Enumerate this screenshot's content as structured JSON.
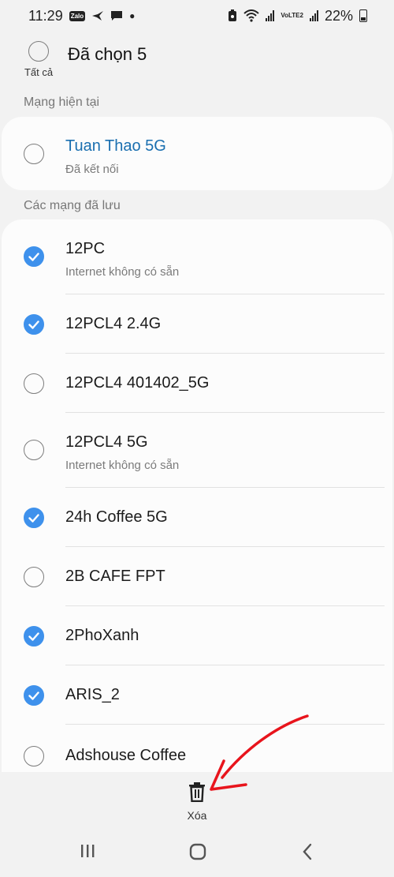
{
  "status_bar": {
    "time": "11:29",
    "zalo": "Zalo",
    "network": "VoLTE2",
    "battery": "22%"
  },
  "header": {
    "select_all_label": "Tất cả",
    "title": "Đã chọn 5"
  },
  "current_section": {
    "label": "Mạng hiện tại",
    "network": {
      "name": "Tuan Thao 5G",
      "status": "Đã kết nối",
      "checked": false
    }
  },
  "saved_section": {
    "label": "Các mạng đã lưu",
    "networks": [
      {
        "name": "12PC",
        "status": "Internet không có sẵn",
        "checked": true
      },
      {
        "name": "12PCL4 2.4G",
        "status": "",
        "checked": true
      },
      {
        "name": "12PCL4 401402_5G",
        "status": "",
        "checked": false
      },
      {
        "name": "12PCL4 5G",
        "status": "Internet không có sẵn",
        "checked": false
      },
      {
        "name": "24h Coffee 5G",
        "status": "",
        "checked": true
      },
      {
        "name": "2B CAFE FPT",
        "status": "",
        "checked": false
      },
      {
        "name": "2PhoXanh",
        "status": "",
        "checked": true
      },
      {
        "name": "ARIS_2",
        "status": "",
        "checked": true
      },
      {
        "name": "Adshouse Coffee",
        "status": "",
        "checked": false
      }
    ]
  },
  "bottom": {
    "delete_label": "Xóa"
  },
  "colors": {
    "accent": "#3e91ec",
    "connected": "#1a6fb0",
    "annotation": "#e8141c"
  },
  "icons": [
    "trash-icon",
    "recents-icon",
    "home-icon",
    "back-icon",
    "wifi-icon",
    "battery-icon"
  ]
}
